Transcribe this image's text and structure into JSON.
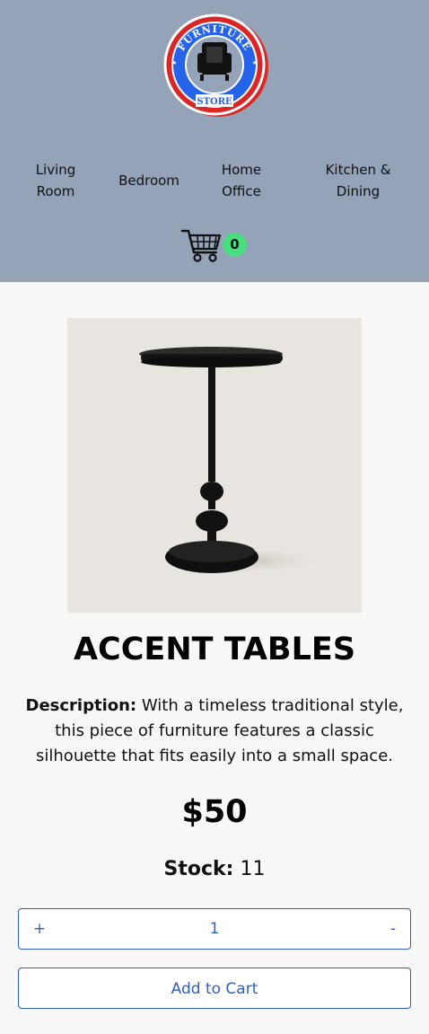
{
  "header": {
    "logo": {
      "top_text": "FURNITURE",
      "bottom_text": "STORE",
      "icon": "armchair-icon"
    },
    "nav": [
      {
        "line1": "Living",
        "line2": "Room"
      },
      {
        "line1": "Bedroom",
        "line2": ""
      },
      {
        "line1": "Home",
        "line2": "Office"
      },
      {
        "line1": "Kitchen &",
        "line2": "Dining"
      }
    ],
    "cart": {
      "icon": "shopping-cart-icon",
      "count": "0"
    }
  },
  "product": {
    "image_icon": "accent-table-image",
    "title": "ACCENT TABLES",
    "description_label": "Description:",
    "description_text": "With a timeless traditional style, this piece of furniture features a classic silhouette that fits easily into a small space.",
    "price": "$50",
    "stock_label": "Stock:",
    "stock_value": "11"
  },
  "quantity": {
    "plus": "+",
    "value": "1",
    "minus": "-"
  },
  "actions": {
    "add_to_cart": "Add to Cart"
  },
  "colors": {
    "header_bg": "#94a3b8",
    "accent_blue": "#2f5fc4",
    "badge_green": "#4ade80",
    "logo_red": "#dc2626",
    "logo_blue": "#2563eb"
  }
}
